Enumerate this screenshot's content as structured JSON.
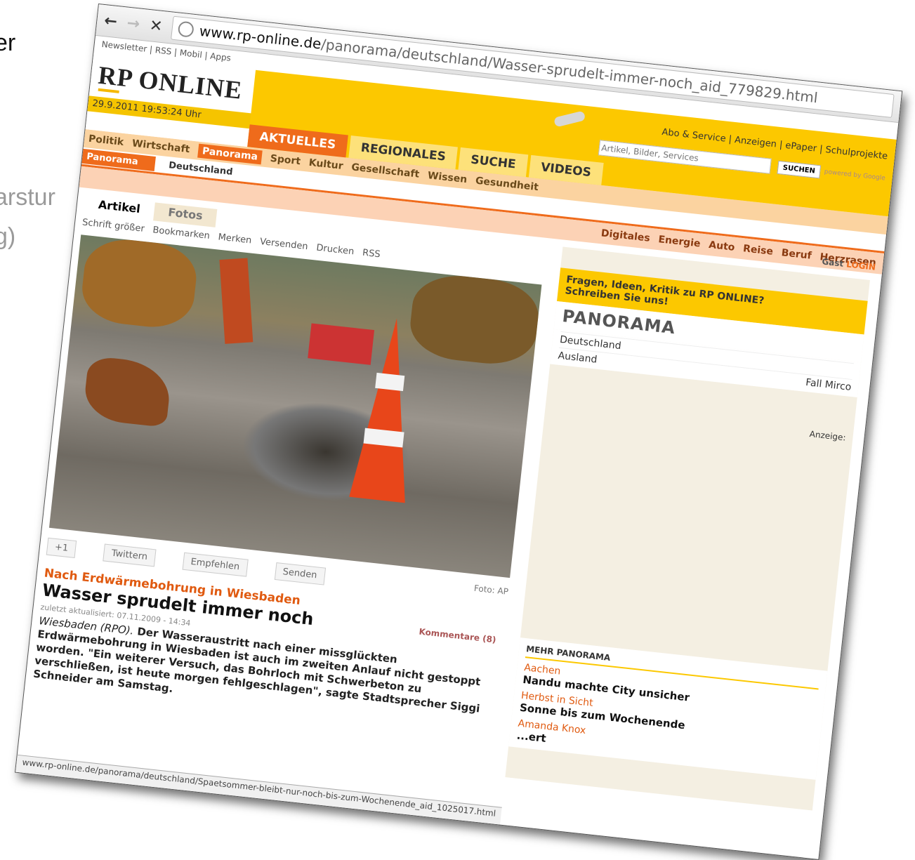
{
  "background": {
    "line1": "er",
    "line2": "arstur",
    "line3": "g)"
  },
  "browser": {
    "url_host": "www.rp-online.de",
    "url_path": "/panorama/deutschland/Wasser-sprudelt-immer-noch_aid_779829.html",
    "status_url": "www.rp-online.de/panorama/deutschland/Spaetsommer-bleibt-nur-noch-bis-zum-Wochenende_aid_1025017.html"
  },
  "site": {
    "toplinks": "Newsletter | RSS | Mobil | Apps",
    "logo": "RP ONLINE",
    "datetime": "29.9.2011 19:53:24 Uhr",
    "service_links": "Abo & Service | Anzeigen | ePaper | Schulprojekte",
    "search_placeholder": "Artikel, Bilder, Services",
    "search_button": "SUCHEN",
    "powered": "powered by Google",
    "tabs": [
      "AKTUELLES",
      "REGIONALES",
      "SUCHE",
      "VIDEOS"
    ],
    "categories": [
      "Politik",
      "Wirtschaft",
      "Panorama",
      "Sport",
      "Kultur",
      "Gesellschaft",
      "Wissen",
      "Gesundheit"
    ],
    "categories2": [
      "Digitales",
      "Energie",
      "Auto",
      "Reise",
      "Beruf",
      "Herzrasen"
    ],
    "crumb_section": "Panorama",
    "crumb_sub": "Deutschland",
    "guest": "Gast",
    "login": "LOGIN"
  },
  "article": {
    "tab_article": "Artikel",
    "tab_photos": "Fotos",
    "font_bigger": "Schrift größer",
    "tools": [
      "Bookmarken",
      "Merken",
      "Versenden",
      "Drucken",
      "RSS"
    ],
    "plus_one": "+1",
    "twitter": "Twittern",
    "facebook": "Empfehlen",
    "send": "Senden",
    "photo_credit": "Foto: AP",
    "kicker": "Nach Erdwärmebohrung in Wiesbaden",
    "headline": "Wasser sprudelt immer noch",
    "comments": "Kommentare (8)",
    "updated": "zuletzt aktualisiert: 07.11.2009 - 14:34",
    "teaser_location": "Wiesbaden (RPO).",
    "teaser_body": "Der Wasseraustritt nach einer missglückten Erdwärmebohrung in Wiesbaden ist auch im zweiten Anlauf nicht gestoppt worden. \"Ein weiterer Versuch, das Bohrloch mit Schwerbeton zu verschließen, ist heute morgen fehlgeschlagen\", sagte Stadtsprecher Siggi Schneider am Samstag."
  },
  "sidebar": {
    "feedback_line1": "Fragen, Ideen, Kritik zu RP ONLINE?",
    "feedback_line2": "Schreiben Sie uns!",
    "panorama_title": "PANORAMA",
    "link_deutschland": "Deutschland",
    "link_ausland": "Ausland",
    "link_fall": "Fall Mirco",
    "ad_label": "Anzeige:",
    "mehr_title": "MEHR PANORAMA",
    "mehr_items": [
      {
        "kicker": "Aachen",
        "title": "Nandu machte City unsicher"
      },
      {
        "kicker": "Herbst in Sicht",
        "title": "Sonne bis zum Wochenende"
      },
      {
        "kicker": "Amanda Knox",
        "title": "...ert"
      }
    ]
  }
}
